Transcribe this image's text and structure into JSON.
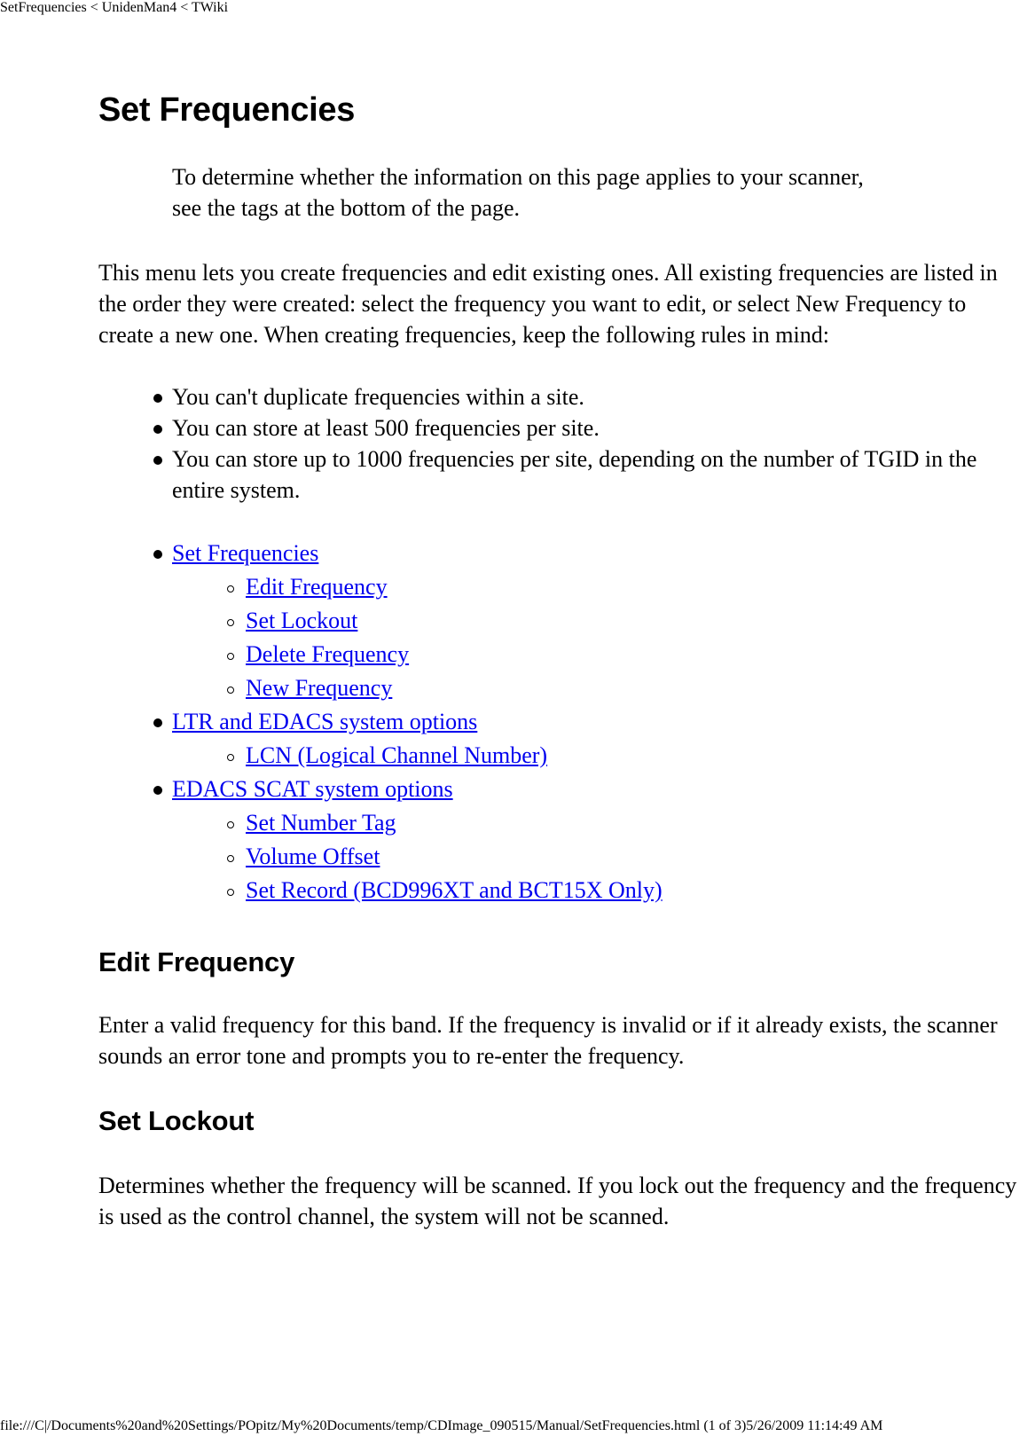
{
  "header": {
    "title": "SetFrequencies < UnidenMan4 < TWiki"
  },
  "main": {
    "title": "Set Frequencies",
    "intro_note": "To determine whether the information on this page applies to your scanner, see the tags at the bottom of the page.",
    "description": "This menu lets you create frequencies and edit existing ones. All existing frequencies are listed in the order they were created: select the frequency you want to edit, or select New Frequency to create a new one. When creating frequencies, keep the following rules in mind:",
    "rules": [
      "You can't duplicate frequencies within a site.",
      "You can store at least 500 frequencies per site.",
      "You can store up to 1000 frequencies per site, depending on the number of TGID in the entire system."
    ],
    "toc": [
      {
        "label": "Set Frequencies",
        "children": [
          {
            "label": "Edit Frequency"
          },
          {
            "label": "Set Lockout"
          },
          {
            "label": "Delete Frequency"
          },
          {
            "label": "New Frequency"
          }
        ]
      },
      {
        "label": "LTR and EDACS system options",
        "children": [
          {
            "label": "LCN (Logical Channel Number)"
          }
        ]
      },
      {
        "label": "EDACS SCAT system options",
        "children": [
          {
            "label": "Set Number Tag"
          },
          {
            "label": "Volume Offset"
          },
          {
            "label": "Set Record (BCD996XT and BCT15X Only)"
          }
        ]
      }
    ],
    "sections": [
      {
        "heading": "Edit Frequency",
        "body": "Enter a valid frequency for this band. If the frequency is invalid or if it already exists, the scanner sounds an error tone and prompts you to re-enter the frequency."
      },
      {
        "heading": "Set Lockout",
        "body": "Determines whether the frequency will be scanned. If you lock out the frequency and the frequency is used as the control channel, the system will not be scanned."
      }
    ]
  },
  "footer": {
    "path": "file:///C|/Documents%20and%20Settings/POpitz/My%20Documents/temp/CDImage_090515/Manual/SetFrequencies.html (1 of 3)5/26/2009 11:14:49 AM"
  },
  "colors": {
    "link": "#0000ee",
    "text": "#000000",
    "background": "#ffffff"
  }
}
